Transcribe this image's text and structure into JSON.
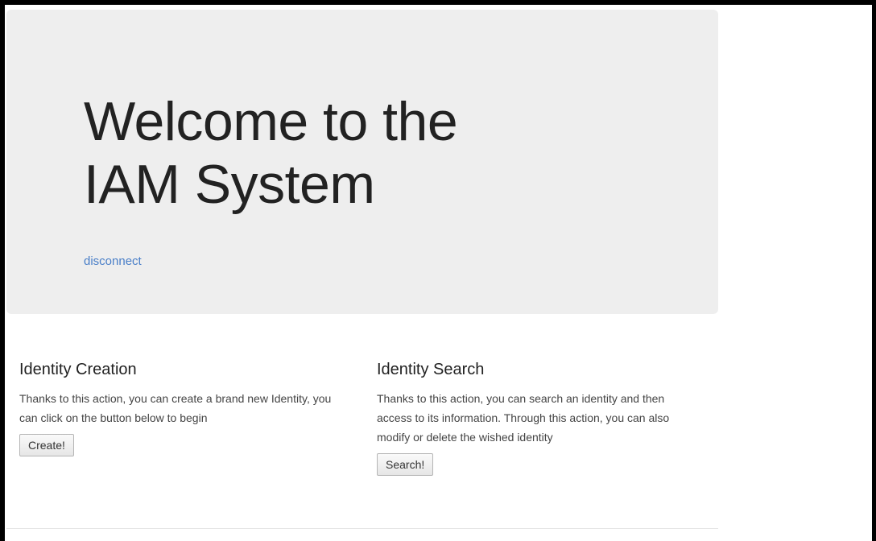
{
  "hero": {
    "title_line1": "Welcome to the",
    "title_line2": "IAM System",
    "disconnect_label": "disconnect"
  },
  "identity_creation": {
    "heading": "Identity Creation",
    "description": "Thanks to this action, you can create a brand new Identity, you can click on the button below to begin",
    "button_label": "Create!"
  },
  "identity_search": {
    "heading": "Identity Search",
    "description": "Thanks to this action, you can search an identity and then access to its information. Through this action, you can also modify or delete the wished identity",
    "button_label": "Search!"
  },
  "colors": {
    "jumbotron_bg": "#eeeeee",
    "link": "#4a7fc8",
    "text": "#333333"
  }
}
